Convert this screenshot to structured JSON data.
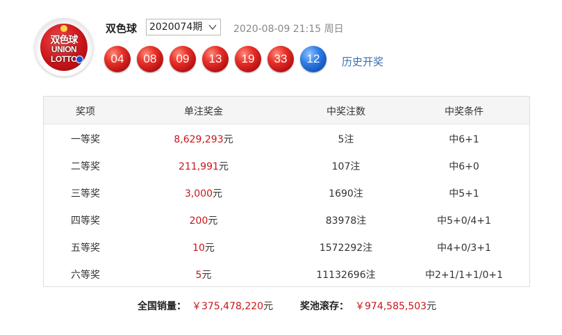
{
  "logo": {
    "cn": "双色球",
    "en_line1": "UNION",
    "en_line2": "LOTTO"
  },
  "header": {
    "name": "双色球",
    "issue": "2020074期",
    "draw_time": "2020-08-09 21:15 周日",
    "history_link": "历史开奖"
  },
  "balls": {
    "red": [
      "04",
      "08",
      "09",
      "13",
      "19",
      "33"
    ],
    "blue": "12"
  },
  "colors": {
    "accent_red": "#c8141a",
    "link_blue": "#3b6fb6",
    "blue_ball": "#1f6fd8"
  },
  "table": {
    "headers": [
      "奖项",
      "单注奖金",
      "中奖注数",
      "中奖条件"
    ],
    "currency_unit": "元",
    "rows": [
      {
        "prize": "一等奖",
        "amount": "8,629,293",
        "count": "5注",
        "condition": "中6+1"
      },
      {
        "prize": "二等奖",
        "amount": "211,991",
        "count": "107注",
        "condition": "中6+0"
      },
      {
        "prize": "三等奖",
        "amount": "3,000",
        "count": "1690注",
        "condition": "中5+1"
      },
      {
        "prize": "四等奖",
        "amount": "200",
        "count": "83978注",
        "condition": "中5+0/4+1"
      },
      {
        "prize": "五等奖",
        "amount": "10",
        "count": "1572292注",
        "condition": "中4+0/3+1"
      },
      {
        "prize": "六等奖",
        "amount": "5",
        "count": "11132696注",
        "condition": "中2+1/1+1/0+1"
      }
    ]
  },
  "summary": {
    "sales_label": "全国销量：",
    "sales_value": "￥375,478,220",
    "pool_label": "奖池滚存：",
    "pool_value": "￥974,585,503",
    "unit": "元"
  }
}
